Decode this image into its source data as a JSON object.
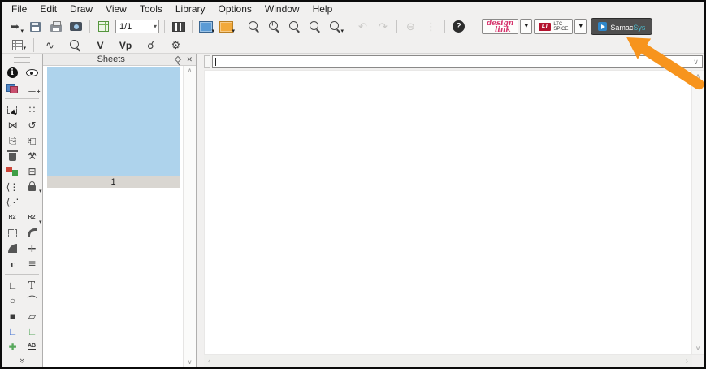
{
  "colors": {
    "accent_orange": "#F7941D",
    "thumbnail_blue": "#AED3EC",
    "chrome_gray": "#F1F0EF",
    "samacsys_bg": "#4F4F4F",
    "samacsys_accent": "#4BB8C9",
    "designlink_red": "#D6336C",
    "lt_red": "#B3122E"
  },
  "menu_bar": {
    "items": [
      {
        "label": "File"
      },
      {
        "label": "Edit"
      },
      {
        "label": "Draw"
      },
      {
        "label": "View"
      },
      {
        "label": "Tools"
      },
      {
        "label": "Library"
      },
      {
        "label": "Options"
      },
      {
        "label": "Window"
      },
      {
        "label": "Help"
      }
    ]
  },
  "toolbar_main": {
    "items": [
      {
        "name": "open-import-button",
        "glyph": "➥",
        "dropdown": true
      },
      {
        "name": "save-button",
        "css": "ic-floppy"
      },
      {
        "name": "print-button",
        "css": "ic-printer"
      },
      {
        "name": "screenshot-button",
        "css": "ic-camera"
      },
      {
        "kind": "sep"
      },
      {
        "name": "sheet-format-button",
        "css": "ic-gridg"
      },
      {
        "kind": "combo",
        "name": "page-selector",
        "value": "1/1"
      },
      {
        "kind": "sep"
      },
      {
        "name": "component-browser-button",
        "css": "ic-piano"
      },
      {
        "kind": "sep"
      },
      {
        "name": "schematic-view-button",
        "css": "ic-sch",
        "dropdown": true
      },
      {
        "name": "layout-view-button",
        "css": "ic-lay",
        "dropdown": true
      },
      {
        "kind": "sep"
      },
      {
        "name": "zoom-out-button",
        "css": "ic-mag",
        "sub": "−"
      },
      {
        "name": "zoom-in-button",
        "css": "ic-mag",
        "sub": "+"
      },
      {
        "name": "zoom-previous-button",
        "css": "ic-mag",
        "sub": "−"
      },
      {
        "name": "zoom-window-button",
        "css": "ic-mag"
      },
      {
        "name": "zoom-all-button",
        "css": "ic-mag",
        "dropdown": true
      },
      {
        "kind": "sep"
      },
      {
        "name": "undo-button",
        "glyph": "↶",
        "disabled": true
      },
      {
        "name": "redo-button",
        "glyph": "↷",
        "disabled": true
      },
      {
        "kind": "sep"
      },
      {
        "name": "remove-button",
        "glyph": "⊖",
        "disabled": true
      },
      {
        "name": "more-options-button",
        "glyph": "⋮",
        "disabled": true
      },
      {
        "kind": "sep"
      },
      {
        "name": "help-button",
        "css": "ic-help",
        "text": "?"
      }
    ],
    "design_link": {
      "line1": "design",
      "line2": "link"
    },
    "ltspice": {
      "logo": "LT",
      "line1": "LTC",
      "line2": "SPICE"
    },
    "samacsys": {
      "label": "Samac",
      "accent": "Sys"
    },
    "dropdown_glyph": "▼"
  },
  "toolbar_sim": {
    "items": [
      {
        "name": "grid-settings-button",
        "css": "ic-gridd",
        "dropdown": true
      },
      {
        "kind": "sep"
      },
      {
        "name": "simulation-signal-button",
        "glyph": "∿"
      },
      {
        "name": "probe-magnifier-button",
        "css": "ic-mag"
      },
      {
        "name": "voltage-probe-button",
        "text": "V"
      },
      {
        "name": "voltage-phase-probe-button",
        "text": "Vp"
      },
      {
        "name": "probe-connect-button",
        "glyph": "☌"
      },
      {
        "name": "simulation-settings-button",
        "glyph": "⚙"
      }
    ]
  },
  "sidebar": {
    "items": [
      {
        "name": "info-button",
        "css": "ic-info",
        "text": "i"
      },
      {
        "name": "visibility-button",
        "css": "ic-eye"
      },
      {
        "name": "layer-select-button",
        "css": "ic-layers"
      },
      {
        "name": "origin-button",
        "glyph": "⊥",
        "sub": "+"
      },
      {
        "kind": "sep"
      },
      {
        "name": "select-button",
        "css": "ic-select"
      },
      {
        "name": "move-button",
        "glyph": "∷"
      },
      {
        "name": "mirror-button",
        "glyph": "⋈"
      },
      {
        "name": "rotate-button",
        "glyph": "↺"
      },
      {
        "name": "copy-button",
        "glyph": "⎘"
      },
      {
        "name": "paste-button",
        "glyph": "⎗"
      },
      {
        "name": "delete-button",
        "css": "ic-trash"
      },
      {
        "name": "edit-functions-button",
        "glyph": "⚒"
      },
      {
        "name": "layer-colors-button",
        "css": "ic-colorsq"
      },
      {
        "name": "move-selection-button",
        "glyph": "⊞"
      },
      {
        "name": "wire-mode-button",
        "glyph": "⟨⋮"
      },
      {
        "name": "lock-button",
        "css": "ic-lock",
        "dropdown": true
      },
      {
        "name": "wire-mode-alt-button",
        "glyph": "⟨⋰"
      },
      {
        "kind": "empty"
      },
      {
        "name": "renumber-button",
        "css": "ic-r2",
        "text": "R2"
      },
      {
        "name": "renumber-options-button",
        "css": "ic-r2",
        "text": "R2",
        "dropdown": true
      },
      {
        "name": "rubberband-button",
        "css": "ic-dashbox"
      },
      {
        "name": "round-corner-button",
        "css": "ic-qcorner"
      },
      {
        "name": "filled-corner-button",
        "css": "ic-fcorner"
      },
      {
        "name": "junction-star-button",
        "glyph": "✛"
      },
      {
        "name": "fill-toggle-button",
        "glyph": "◐"
      },
      {
        "name": "list-compare-button",
        "glyph": "≣"
      },
      {
        "kind": "sep"
      },
      {
        "name": "draw-line-button",
        "glyph": "∟"
      },
      {
        "name": "draw-text-button",
        "text": "T"
      },
      {
        "name": "draw-circle-button",
        "glyph": "○"
      },
      {
        "name": "draw-arc-button",
        "glyph": "⌒"
      },
      {
        "name": "draw-rectangle-button",
        "glyph": "■"
      },
      {
        "name": "draw-polygon-button",
        "glyph": "▱"
      },
      {
        "name": "draw-bus-button",
        "glyph": "∟",
        "color": "#3f6fd0"
      },
      {
        "name": "draw-wire-button",
        "glyph": "∟",
        "color": "#57a85c"
      },
      {
        "name": "add-node-button",
        "glyph": "✚",
        "color": "#57a85c"
      },
      {
        "name": "label-button",
        "css": "ic-ab",
        "text": "AB"
      },
      {
        "kind": "chevron",
        "name": "sidebar-more-button",
        "glyph": "»"
      }
    ]
  },
  "sheets_panel": {
    "title": "Sheets",
    "sheet_number": "1",
    "close_glyph": "✕"
  },
  "canvas": {
    "combobox_value": "",
    "dropdown_glyph": "∨"
  },
  "scrollbars": {
    "up": "∧",
    "down": "∨",
    "left": "‹",
    "right": "›"
  }
}
